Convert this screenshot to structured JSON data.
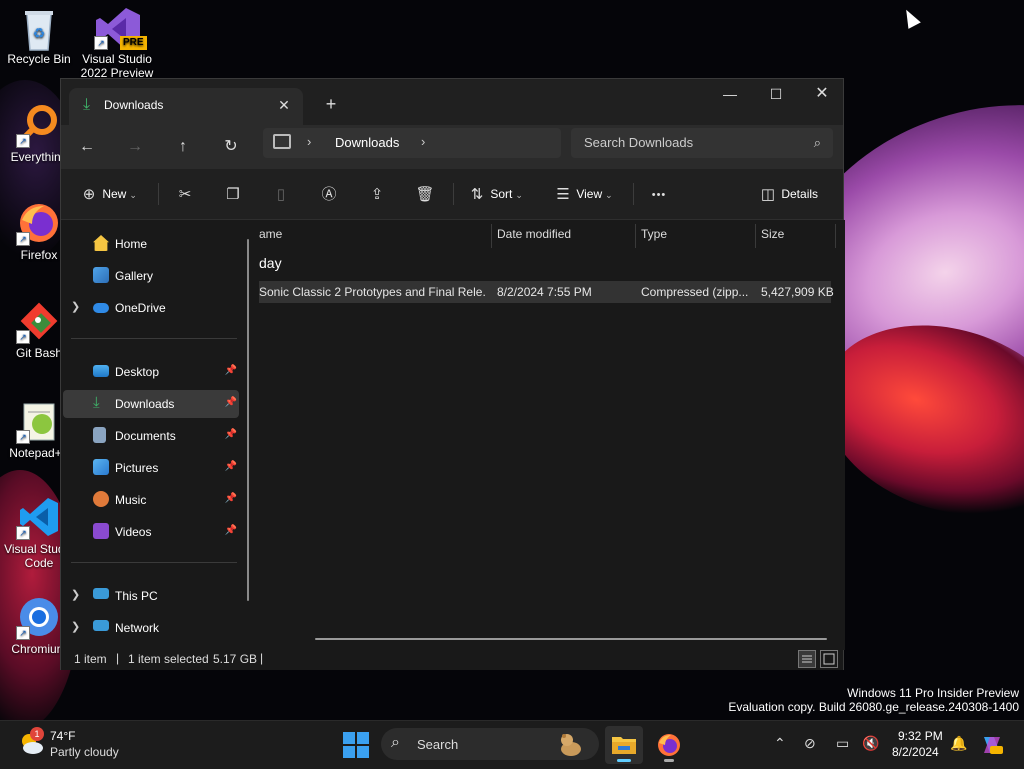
{
  "desktop": {
    "icons": [
      {
        "label": "Recycle Bin",
        "icon": "recycle-bin-icon"
      },
      {
        "label": "Visual Studio 2022 Preview",
        "icon": "visual-studio-icon",
        "badge": "PRE"
      },
      {
        "label": "Everything",
        "icon": "everything-search-icon"
      },
      {
        "label": "Firefox",
        "icon": "firefox-icon"
      },
      {
        "label": "Git Bash",
        "icon": "git-bash-icon"
      },
      {
        "label": "Notepad++",
        "icon": "notepad-plus-plus-icon"
      },
      {
        "label": "Visual Studio Code",
        "icon": "vscode-icon"
      },
      {
        "label": "Chromium",
        "icon": "chromium-icon"
      }
    ]
  },
  "explorer": {
    "tab": {
      "title": "Downloads",
      "close": "✕"
    },
    "new_tab": "+",
    "window_controls": {
      "minimize": "—",
      "maximize": "☐",
      "close": "✕"
    },
    "nav": {
      "back": "←",
      "forward": "→",
      "up": "↑",
      "refresh": "↻"
    },
    "address": {
      "separator": "›",
      "location": "Downloads"
    },
    "search": {
      "placeholder": "Search Downloads",
      "icon": "⌕"
    },
    "commands": {
      "new": "New",
      "sort": "Sort",
      "view": "View",
      "more": "•••",
      "details": "Details"
    },
    "nav_pane": {
      "home": "Home",
      "gallery": "Gallery",
      "onedrive": "OneDrive",
      "desktop": "Desktop",
      "downloads": "Downloads",
      "documents": "Documents",
      "pictures": "Pictures",
      "music": "Music",
      "videos": "Videos",
      "this_pc": "This PC",
      "network": "Network"
    },
    "columns": {
      "name": "ame",
      "date": "Date modified",
      "type": "Type",
      "size": "Size"
    },
    "group": "day",
    "files": [
      {
        "name": "Sonic Classic 2 Prototypes and Final Rele...",
        "date": "8/2/2024 7:55 PM",
        "type": "Compressed (zipp...",
        "size": "5,427,909 KB"
      }
    ],
    "status": {
      "count": "1 item",
      "selected": "1 item selected",
      "size": "5.17 GB",
      "separator": "|"
    }
  },
  "watermark": {
    "line1": "Windows 11 Pro Insider Preview",
    "line2": "Evaluation copy. Build 26080.ge_release.240308-1400"
  },
  "taskbar": {
    "weather": {
      "temp": "74°F",
      "condition": "Partly cloudy",
      "alert_count": "1"
    },
    "search": "Search",
    "clock": {
      "time": "9:32 PM",
      "date": "8/2/2024"
    }
  },
  "colors": {
    "accent": "#60cdff",
    "download_green": "#3fb46a",
    "folder_yellow": "#f5c542"
  }
}
